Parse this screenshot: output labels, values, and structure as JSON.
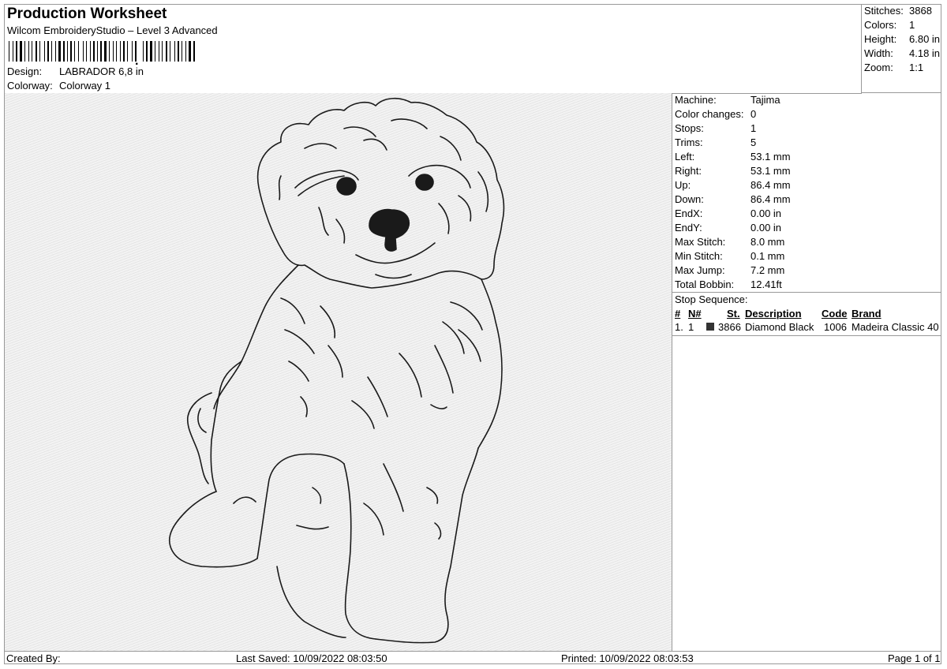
{
  "header": {
    "title": "Production Worksheet",
    "subtitle": "Wilcom EmbroideryStudio – Level 3 Advanced",
    "barcode_icon": "barcode-icon",
    "design_label": "Design:",
    "design_value": "LABRADOR 6,8 in",
    "colorway_label": "Colorway:",
    "colorway_value": "Colorway 1"
  },
  "stats": [
    {
      "label": "Stitches:",
      "value": "3868"
    },
    {
      "label": "Colors:",
      "value": "1"
    },
    {
      "label": "Height:",
      "value": "6.80 in"
    },
    {
      "label": "Width:",
      "value": "4.18 in"
    },
    {
      "label": "Zoom:",
      "value": "1:1"
    }
  ],
  "machine_info": [
    {
      "label": "Machine:",
      "value": "Tajima"
    },
    {
      "label": "Color changes:",
      "value": "0"
    },
    {
      "label": "Stops:",
      "value": "1"
    },
    {
      "label": "Trims:",
      "value": "5"
    },
    {
      "label": "Left:",
      "value": "53.1 mm"
    },
    {
      "label": "Right:",
      "value": "53.1 mm"
    },
    {
      "label": "Up:",
      "value": "86.4 mm"
    },
    {
      "label": "Down:",
      "value": "86.4 mm"
    },
    {
      "label": "EndX:",
      "value": "0.00 in"
    },
    {
      "label": "EndY:",
      "value": "0.00 in"
    },
    {
      "label": "Max Stitch:",
      "value": "8.0 mm"
    },
    {
      "label": "Min Stitch:",
      "value": "0.1 mm"
    },
    {
      "label": "Max Jump:",
      "value": "7.2 mm"
    },
    {
      "label": "Total Bobbin:",
      "value": "12.41ft"
    }
  ],
  "stop_sequence": {
    "title": "Stop Sequence:",
    "columns": {
      "hash": "#",
      "n": "N#",
      "st": "St.",
      "description": "Description",
      "code": "Code",
      "brand": "Brand"
    },
    "rows": [
      {
        "index": "1.",
        "n": "1",
        "color": "#333333",
        "st": "3866",
        "description": "Diamond Black",
        "code": "1006",
        "brand": "Madeira Classic 40"
      }
    ]
  },
  "design_preview": {
    "subject": "puppy-outline-embroidery",
    "thread_color": "#1a1a1a"
  },
  "footer": {
    "created_by": "Created By:",
    "last_saved": "Last Saved: 10/09/2022 08:03:50",
    "printed": "Printed: 10/09/2022 08:03:53",
    "page": "Page 1 of 1"
  }
}
